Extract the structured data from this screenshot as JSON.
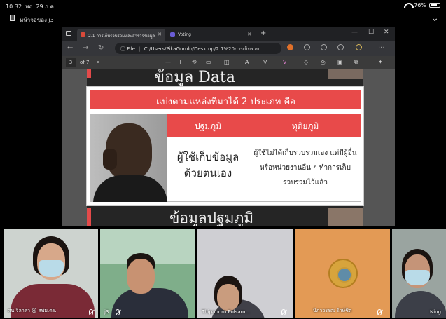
{
  "status_bar": {
    "time": "10:32",
    "date": "พฤ. 29 ก.ค.",
    "battery": "76%",
    "battery_level": 0.76
  },
  "meeting": {
    "title": "หน้าจอของ j3"
  },
  "browser": {
    "tabs": [
      {
        "label": "2.1 การเก็บรวบรวมและสำรวจข้อมูล",
        "active": true
      },
      {
        "label": "Voting",
        "active": false
      }
    ],
    "file_label": "File",
    "url": "C:/Users/PikaGurolo/Desktop/2.1%20การเก็บรวบ...",
    "pdf": {
      "page_current": "3",
      "page_total": "of 7"
    }
  },
  "slide": {
    "top_heading": "ข้อมูล Data",
    "banner": "แบ่งตามแหล่งที่มาได้ 2 ประเภท คือ",
    "table": {
      "headers": [
        "ปฐมภูมิ",
        "ทุติยภูมิ"
      ],
      "cells": [
        "ผู้ใช้เก็บข้อมูล ด้วยตนเอง",
        "ผู้ใช้ไม่ได้เก็บรวบรวมเอง แต่มีผู้อื่นหรือหน่วยงานอื่น ๆ ทำการเก็บรวบรวมไว้แล้ว"
      ]
    },
    "bottom_heading": "ข้อมูลปฐมภูมิ"
  },
  "participants": [
    {
      "name": "ศน.จิลาลา @ สพม.ตร."
    },
    {
      "name": "j3"
    },
    {
      "name": "Thipaporn Polsam..."
    },
    {
      "name": "นิภาวรรณ รักษ์ชิต"
    },
    {
      "name": "Ning"
    }
  ],
  "colors": {
    "slide_red": "#e84a4a",
    "browser_dark": "#202124",
    "toolbar": "#35363a"
  }
}
